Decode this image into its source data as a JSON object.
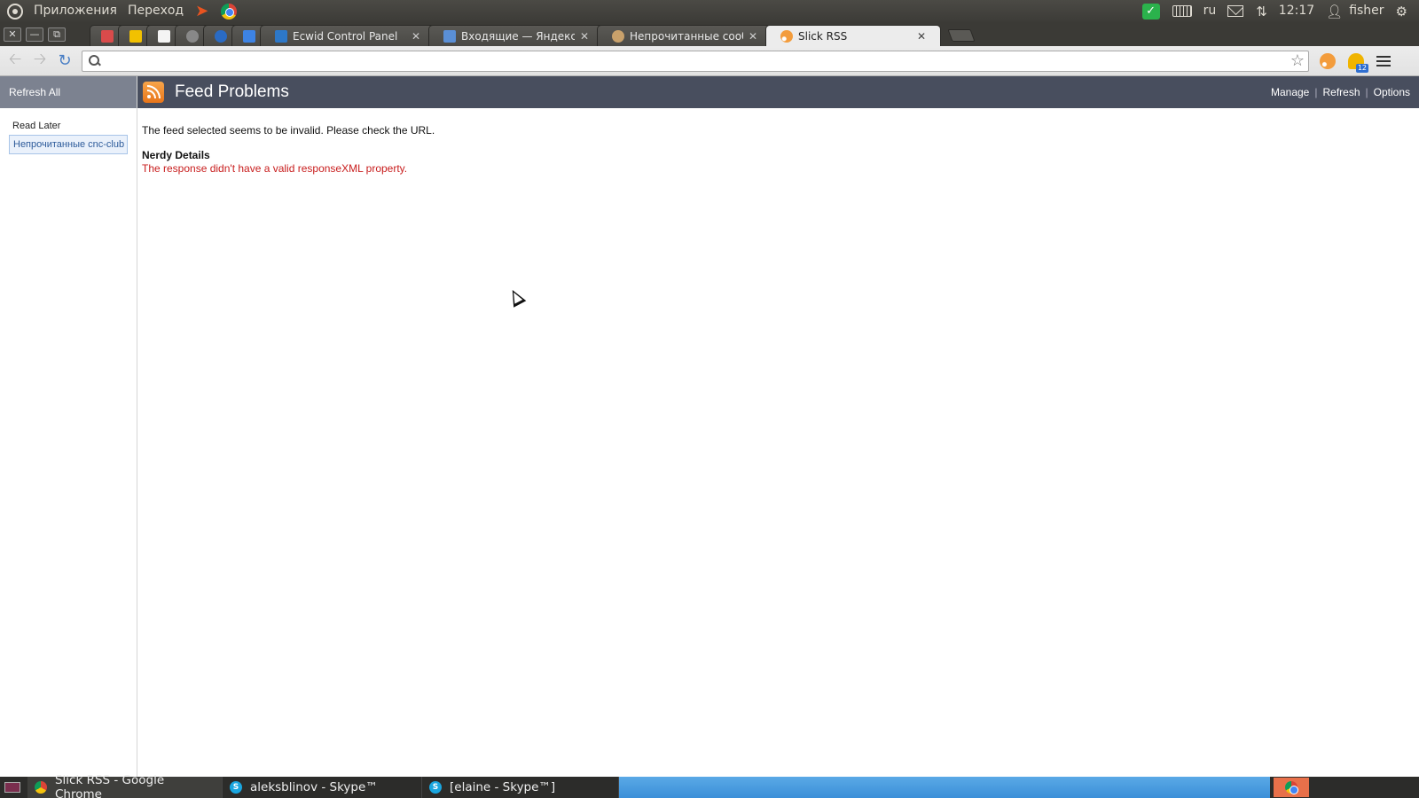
{
  "top_panel": {
    "menus": [
      "Приложения",
      "Переход"
    ],
    "keyboard_layout": "ru",
    "time": "12:17",
    "user": "fisher"
  },
  "browser": {
    "tabs": [
      {
        "label": "Ecwid Control Panel",
        "active": false
      },
      {
        "label": "Входящие — Яндекс.Почта",
        "active": false
      },
      {
        "label": "Непрочитанные сообщения",
        "active": false
      },
      {
        "label": "Slick RSS",
        "active": true
      }
    ],
    "address_value": "",
    "notification_badge": "12"
  },
  "sidebar": {
    "refresh_all": "Refresh All",
    "items": [
      {
        "label": "Read Later",
        "selected": false
      },
      {
        "label": "Непрочитанные cnc-club",
        "selected": true
      }
    ]
  },
  "main": {
    "title": "Feed Problems",
    "links": {
      "manage": "Manage",
      "refresh": "Refresh",
      "options": "Options"
    },
    "message": "The feed selected seems to be invalid. Please check the URL.",
    "nerdy_title": "Nerdy Details",
    "nerdy_detail": "The response didn't have a valid responseXML property."
  },
  "taskbar": {
    "tasks": [
      {
        "label": "Slick RSS - Google Chrome"
      },
      {
        "label": "aleksblinov - Skype™"
      },
      {
        "label": "[elaine - Skype™]"
      }
    ]
  },
  "colors": {
    "header_bg": "#484e5e",
    "sidebar_header_bg": "#7c8290",
    "error_text": "#c81d1d",
    "rss_orange": "#e8751a"
  }
}
